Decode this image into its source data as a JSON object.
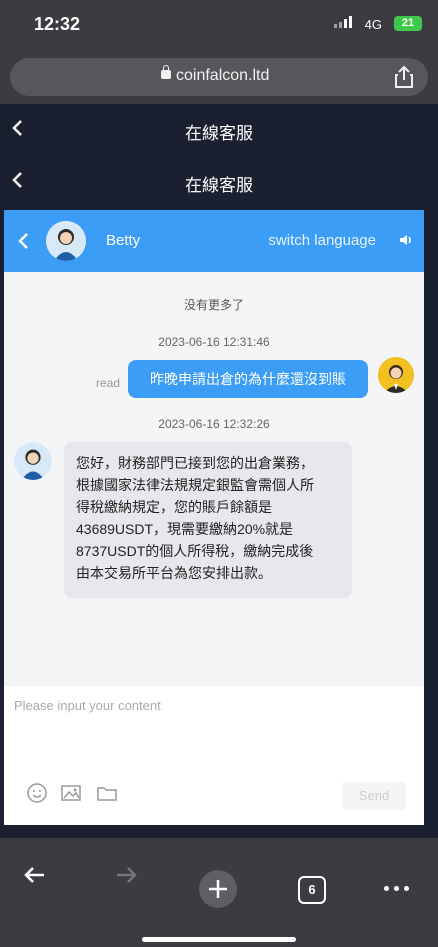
{
  "status_bar": {
    "time": "12:32",
    "network": "4G",
    "battery": "21"
  },
  "browser": {
    "url": "coinfalcon.ltd",
    "tab_count": "6"
  },
  "page_header_1": {
    "title": "在線客服"
  },
  "page_header_2": {
    "title": "在線客服"
  },
  "chat_header": {
    "agent_name": "Betty",
    "switch_language": "switch language"
  },
  "messages": {
    "no_more": "没有更多了",
    "timestamp_1": "2023-06-16 12:31:46",
    "outgoing_text": "昨晚申請出倉的為什麼還沒到賬",
    "outgoing_status": "read",
    "timestamp_2": "2023-06-16 12:32:26",
    "incoming_lines": [
      "您好，財務部門已接到您的出倉業務，",
      "根據國家法律法規規定銀監會需個人所",
      "得稅繳納規定，您的賬戶餘額是",
      "43689USDT，現需要繳納20%就是",
      "8737USDT的個人所得稅，繳納完成後",
      "由本交易所平台為您安排出款。"
    ]
  },
  "composer": {
    "placeholder": "Please input your content",
    "send_label": "Send"
  },
  "colors": {
    "accent": "#3b9df5",
    "battery": "#3ec94a",
    "header_bg": "#1b2030"
  },
  "icons": [
    "back-icon",
    "lock-icon",
    "share-icon",
    "speaker-icon",
    "emoji-icon",
    "image-icon",
    "folder-icon",
    "forward-icon",
    "plus-icon",
    "more-icon"
  ]
}
